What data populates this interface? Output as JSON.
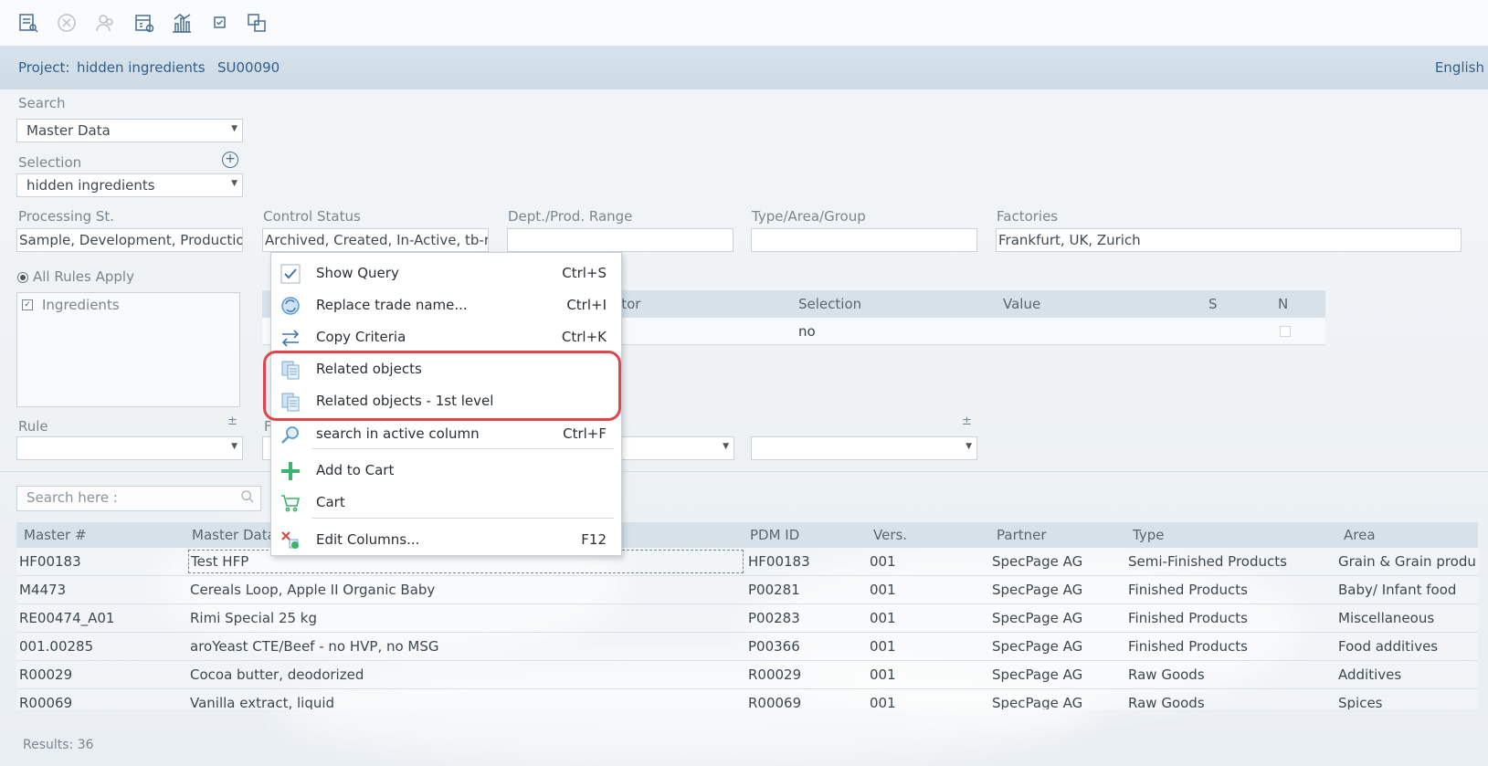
{
  "toolbar": {
    "icons": [
      "query-list-icon",
      "cancel-icon",
      "users-icon",
      "calendar-settings-icon",
      "chart-icon",
      "checkbox-icon",
      "copy-icon"
    ]
  },
  "project": {
    "label": "Project:",
    "name": "hidden ingredients",
    "code": "SU00090",
    "language": "English"
  },
  "search": {
    "label": "Search",
    "value": "Master Data"
  },
  "selection": {
    "label": "Selection",
    "value": "hidden ingredients"
  },
  "filters": {
    "processing_label": "Processing St.",
    "processing_value": "Sample, Development, Production",
    "control_label": "Control Status",
    "control_value": "Archived, Created, In-Active, tb-re",
    "dept_label": "Dept./Prod. Range",
    "dept_value": "",
    "type_label": "Type/Area/Group",
    "type_value": "",
    "factories_label": "Factories",
    "factories_value": "Frankfurt, UK, Zurich"
  },
  "rules": {
    "all_rules_label": "All Rules Apply",
    "item_label": "Ingredients",
    "rule_label": "Rule",
    "rule_value": "",
    "plusminus": "±",
    "hidden_letter": "F"
  },
  "criteria": {
    "col_operator": "ator",
    "col_selection": "Selection",
    "col_value": "Value",
    "col_s": "S",
    "col_n": "N",
    "row_selection": "no"
  },
  "gridsearch": {
    "placeholder": "Search here :"
  },
  "grid": {
    "columns": [
      "Master #",
      "Master Data",
      "PDM ID",
      "Vers.",
      "Partner",
      "Type",
      "Area"
    ],
    "rows": [
      {
        "master": "HF00183",
        "data": "Test HFP",
        "pdm": "HF00183",
        "vers": "001",
        "partner": "SpecPage AG",
        "type": "Semi-Finished Products",
        "area": "Grain & Grain produ"
      },
      {
        "master": "M4473",
        "data": "Cereals Loop, Apple II Organic Baby",
        "pdm": "P00281",
        "vers": "001",
        "partner": "SpecPage AG",
        "type": "Finished Products",
        "area": "Baby/ Infant food"
      },
      {
        "master": "RE00474_A01",
        "data": "Rimi Special 25 kg",
        "pdm": "P00283",
        "vers": "001",
        "partner": "SpecPage AG",
        "type": "Finished Products",
        "area": "Miscellaneous"
      },
      {
        "master": "001.00285",
        "data": "aroYeast CTE/Beef - no HVP, no MSG",
        "pdm": "P00366",
        "vers": "001",
        "partner": "SpecPage AG",
        "type": "Finished Products",
        "area": "Food additives"
      },
      {
        "master": "R00029",
        "data": "Cocoa butter, deodorized",
        "pdm": "R00029",
        "vers": "001",
        "partner": "SpecPage AG",
        "type": "Raw Goods",
        "area": "Additives"
      },
      {
        "master": "R00069",
        "data": "Vanilla extract, liquid",
        "pdm": "R00069",
        "vers": "001",
        "partner": "SpecPage AG",
        "type": "Raw Goods",
        "area": "Spices"
      }
    ],
    "results": "Results: 36"
  },
  "context_menu": {
    "items": [
      {
        "label": "Show Query",
        "shortcut": "Ctrl+S",
        "icon": "checkmark-icon"
      },
      {
        "label": "Replace trade name...",
        "shortcut": "Ctrl+I",
        "icon": "refresh-icon"
      },
      {
        "label": "Copy Criteria",
        "shortcut": "Ctrl+K",
        "icon": "transfer-arrows-icon"
      },
      {
        "label": "Related objects",
        "shortcut": "",
        "icon": "related-objects-icon"
      },
      {
        "label": "Related objects - 1st level",
        "shortcut": "",
        "icon": "related-objects-icon"
      },
      {
        "label": "search in active column",
        "shortcut": "Ctrl+F",
        "icon": "magnifier-icon"
      },
      {
        "label": "Add to Cart",
        "shortcut": "",
        "icon": "plus-icon"
      },
      {
        "label": "Cart",
        "shortcut": "",
        "icon": "cart-icon"
      },
      {
        "label": "Edit Columns...",
        "shortcut": "F12",
        "icon": "edit-columns-icon"
      }
    ]
  },
  "colors": {
    "accent": "#2f5f8a",
    "highlight": "#e0454c",
    "header_bg": "#d6e1ea"
  }
}
